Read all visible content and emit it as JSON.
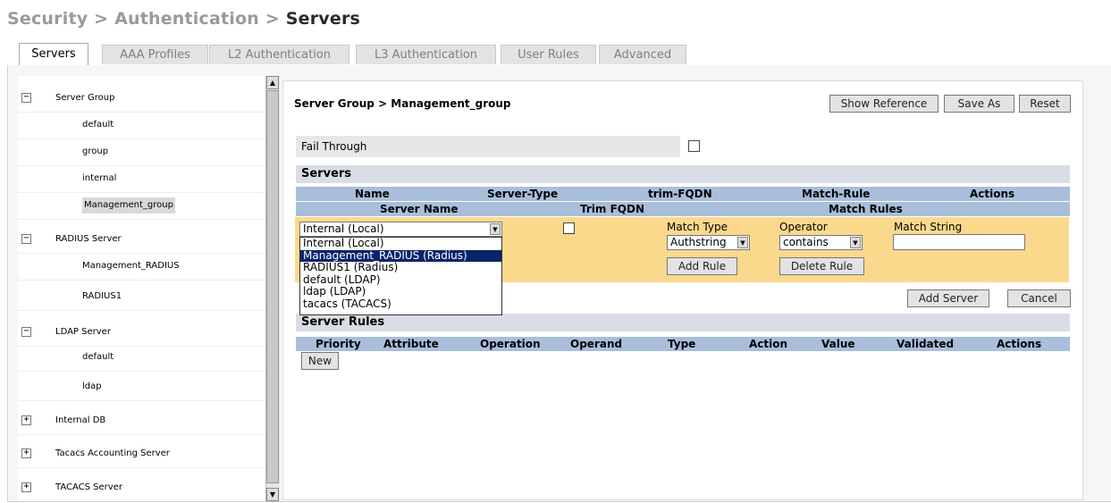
{
  "breadcrumb": {
    "part1": "Security",
    "sep1": " > ",
    "part2": "Authentication",
    "sep2": " > ",
    "current": "Servers"
  },
  "tabs": [
    {
      "label": "Servers",
      "active": true
    },
    {
      "label": "AAA Profiles"
    },
    {
      "label": "L2 Authentication"
    },
    {
      "label": "L3 Authentication"
    },
    {
      "label": "User Rules"
    },
    {
      "label": "Advanced"
    }
  ],
  "tree": [
    {
      "label": "Server Group",
      "expander": "−"
    },
    {
      "label": "default"
    },
    {
      "label": "group"
    },
    {
      "label": "internal"
    },
    {
      "label": "Management_group",
      "selected": true
    },
    {
      "label": "RADIUS Server",
      "expander": "−"
    },
    {
      "label": "Management_RADIUS"
    },
    {
      "label": "RADIUS1"
    },
    {
      "label": "LDAP Server",
      "expander": "−"
    },
    {
      "label": "default"
    },
    {
      "label": "ldap"
    },
    {
      "label": "Internal DB",
      "expander": "+"
    },
    {
      "label": "Tacacs Accounting Server",
      "expander": "+"
    },
    {
      "label": "TACACS Server",
      "expander": "+"
    }
  ],
  "scroll": {
    "up": "▲",
    "down": "▼"
  },
  "panel": {
    "title": "Server Group > Management_group",
    "buttons": {
      "show_reference": "Show Reference",
      "save_as": "Save As",
      "reset": "Reset"
    },
    "fail_through": "Fail Through",
    "servers_section": "Servers",
    "servers_columns": [
      "Name",
      "Server-Type",
      "trim-FQDN",
      "Match-Rule",
      "Actions"
    ],
    "edit_columns": {
      "server_name": "Server Name",
      "trim_fqdn": "Trim FQDN",
      "match_rules": "Match Rules"
    },
    "server_select_value": "Internal (Local)",
    "match_type_label": "Match Type",
    "operator_label": "Operator",
    "match_string_label": "Match String",
    "match_type_value": "Authstring",
    "operator_value": "contains",
    "add_rule": "Add Rule",
    "delete_rule": "Delete Rule",
    "add_server": "Add Server",
    "cancel": "Cancel",
    "server_rules_section": "Server Rules",
    "rules_columns": [
      "Priority",
      "Attribute",
      "Operation",
      "Operand",
      "Type",
      "Action",
      "Value",
      "Validated",
      "Actions"
    ],
    "new_button": "New"
  },
  "dropdown_options": [
    "Internal (Local)",
    "Management_RADIUS (Radius)",
    "RADIUS1 (Radius)",
    "default (LDAP)",
    "ldap (LDAP)",
    "tacacs (TACACS)"
  ],
  "dropdown_highlighted_index": 1,
  "colors": {
    "edit_area": "#fbd98c",
    "column_header": "#a8bedb",
    "section_header": "#d9dde5",
    "highlight": "#0a246a"
  }
}
